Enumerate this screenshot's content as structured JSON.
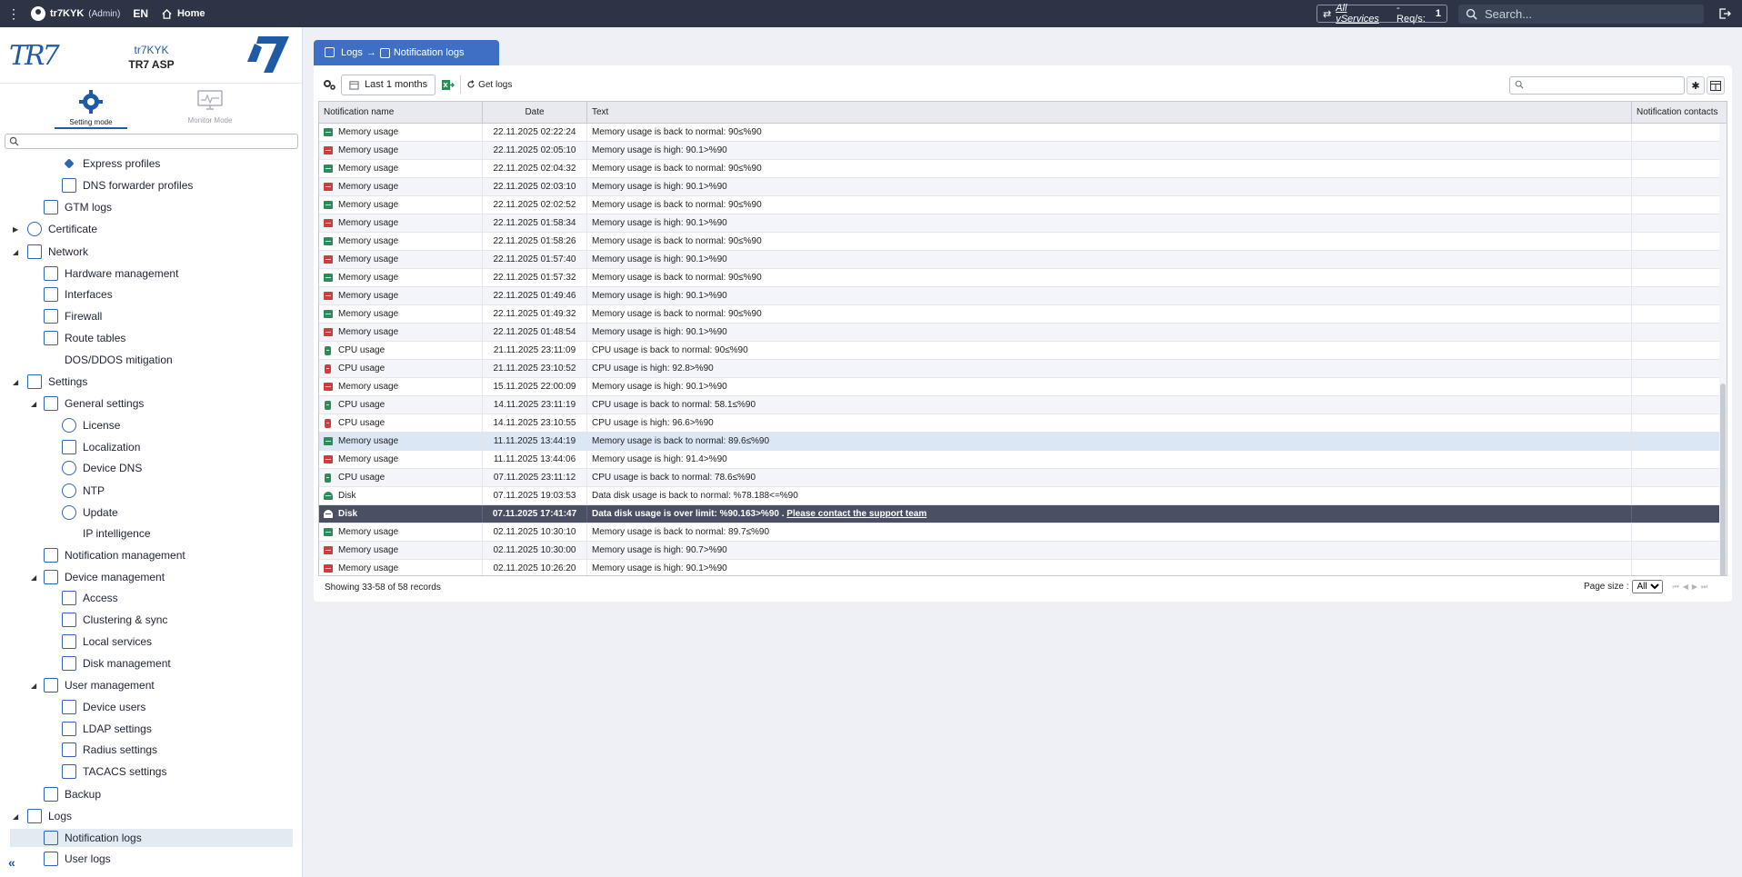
{
  "topbar": {
    "user": "tr7KYK",
    "role": "(Admin)",
    "lang": "EN",
    "home": "Home",
    "vservices_label": "All vServices",
    "reqs_label": "- Req/s:",
    "reqs_value": "1",
    "search_placeholder": "Search..."
  },
  "sidebar": {
    "logo_text": "TR7",
    "device_name": "tr7KYK",
    "model": "TR7 ASP",
    "modes": {
      "setting": "Setting mode",
      "monitor": "Monitor Mode"
    },
    "search_placeholder": "",
    "tree": [
      {
        "label": "Express profiles",
        "icon": "diamond-icon",
        "level": 3,
        "arrow": ""
      },
      {
        "label": "DNS forwarder profiles",
        "icon": "dns-forward-icon",
        "level": 3,
        "arrow": ""
      },
      {
        "label": "GTM logs",
        "icon": "log-list-icon",
        "level": 2,
        "arrow": ""
      },
      {
        "label": "Certificate",
        "icon": "certificate-icon",
        "level": 1,
        "arrow": "▶"
      },
      {
        "label": "Network",
        "icon": "network-icon",
        "level": 1,
        "arrow": "◢"
      },
      {
        "label": "Hardware management",
        "icon": "hardware-icon",
        "level": 2,
        "arrow": ""
      },
      {
        "label": "Interfaces",
        "icon": "interfaces-icon",
        "level": 2,
        "arrow": ""
      },
      {
        "label": "Firewall",
        "icon": "firewall-icon",
        "level": 2,
        "arrow": ""
      },
      {
        "label": "Route tables",
        "icon": "route-icon",
        "level": 2,
        "arrow": ""
      },
      {
        "label": "DOS/DDOS mitigation",
        "icon": "",
        "level": 2,
        "arrow": ""
      },
      {
        "label": "Settings",
        "icon": "gear-icon",
        "level": 1,
        "arrow": "◢"
      },
      {
        "label": "General settings",
        "icon": "settings-list-icon",
        "level": 2,
        "arrow": "◢"
      },
      {
        "label": "License",
        "icon": "license-icon",
        "level": 3,
        "arrow": ""
      },
      {
        "label": "Localization",
        "icon": "location-pin-icon",
        "level": 3,
        "arrow": ""
      },
      {
        "label": "Device DNS",
        "icon": "globe-icon",
        "level": 3,
        "arrow": ""
      },
      {
        "label": "NTP",
        "icon": "clock-icon",
        "level": 3,
        "arrow": ""
      },
      {
        "label": "Update",
        "icon": "update-icon",
        "level": 3,
        "arrow": ""
      },
      {
        "label": "IP intelligence",
        "icon": "",
        "level": 3,
        "arrow": ""
      },
      {
        "label": "Notification management",
        "icon": "bell-icon",
        "level": 2,
        "arrow": ""
      },
      {
        "label": "Device management",
        "icon": "device-icon",
        "level": 2,
        "arrow": "◢"
      },
      {
        "label": "Access",
        "icon": "access-icon",
        "level": 3,
        "arrow": ""
      },
      {
        "label": "Clustering & sync",
        "icon": "cluster-icon",
        "level": 3,
        "arrow": ""
      },
      {
        "label": "Local services",
        "icon": "local-services-icon",
        "level": 3,
        "arrow": ""
      },
      {
        "label": "Disk management",
        "icon": "disk-icon",
        "level": 3,
        "arrow": ""
      },
      {
        "label": "User management",
        "icon": "users-icon",
        "level": 2,
        "arrow": "◢"
      },
      {
        "label": "Device users",
        "icon": "device-users-icon",
        "level": 3,
        "arrow": ""
      },
      {
        "label": "LDAP settings",
        "icon": "wrench-icon",
        "level": 3,
        "arrow": ""
      },
      {
        "label": "Radius settings",
        "icon": "wrench-icon",
        "level": 3,
        "arrow": ""
      },
      {
        "label": "TACACS settings",
        "icon": "wrench-icon",
        "level": 3,
        "arrow": ""
      },
      {
        "label": "Backup",
        "icon": "backup-icon",
        "level": 2,
        "arrow": ""
      },
      {
        "label": "Logs",
        "icon": "logs-icon",
        "level": 1,
        "arrow": "◢"
      },
      {
        "label": "Notification logs",
        "icon": "log-list-icon",
        "level": 2,
        "arrow": "",
        "selected": true
      },
      {
        "label": "User logs",
        "icon": "log-list-icon",
        "level": 2,
        "arrow": ""
      }
    ],
    "collapse_label": "«"
  },
  "breadcrumb": {
    "parent": "Logs",
    "sep": "→",
    "current": "Notification logs"
  },
  "toolbar": {
    "range_label": "Last 1 months",
    "get_logs": "Get logs",
    "search_placeholder": ""
  },
  "table": {
    "columns": [
      "Notification name",
      "Date",
      "Text",
      "Notification contacts"
    ],
    "rows": [
      {
        "name": "Memory usage",
        "icon": "mem-ok",
        "date": "22.11.2025 02:22:24",
        "text": "Memory usage is back to normal: 90≤%90"
      },
      {
        "name": "Memory usage",
        "icon": "mem-bad",
        "date": "22.11.2025 02:05:10",
        "text": "Memory usage is high: 90.1>%90"
      },
      {
        "name": "Memory usage",
        "icon": "mem-ok",
        "date": "22.11.2025 02:04:32",
        "text": "Memory usage is back to normal: 90≤%90"
      },
      {
        "name": "Memory usage",
        "icon": "mem-bad",
        "date": "22.11.2025 02:03:10",
        "text": "Memory usage is high: 90.1>%90"
      },
      {
        "name": "Memory usage",
        "icon": "mem-ok",
        "date": "22.11.2025 02:02:52",
        "text": "Memory usage is back to normal: 90≤%90"
      },
      {
        "name": "Memory usage",
        "icon": "mem-bad",
        "date": "22.11.2025 01:58:34",
        "text": "Memory usage is high: 90.1>%90"
      },
      {
        "name": "Memory usage",
        "icon": "mem-ok",
        "date": "22.11.2025 01:58:26",
        "text": "Memory usage is back to normal: 90≤%90"
      },
      {
        "name": "Memory usage",
        "icon": "mem-bad",
        "date": "22.11.2025 01:57:40",
        "text": "Memory usage is high: 90.1>%90"
      },
      {
        "name": "Memory usage",
        "icon": "mem-ok",
        "date": "22.11.2025 01:57:32",
        "text": "Memory usage is back to normal: 90≤%90"
      },
      {
        "name": "Memory usage",
        "icon": "mem-bad",
        "date": "22.11.2025 01:49:46",
        "text": "Memory usage is high: 90.1>%90"
      },
      {
        "name": "Memory usage",
        "icon": "mem-ok",
        "date": "22.11.2025 01:49:32",
        "text": "Memory usage is back to normal: 90≤%90"
      },
      {
        "name": "Memory usage",
        "icon": "mem-bad",
        "date": "22.11.2025 01:48:54",
        "text": "Memory usage is high: 90.1>%90"
      },
      {
        "name": "CPU usage",
        "icon": "cpu-ok",
        "date": "21.11.2025 23:11:09",
        "text": "CPU usage is back to normal: 90≤%90"
      },
      {
        "name": "CPU usage",
        "icon": "cpu-bad",
        "date": "21.11.2025 23:10:52",
        "text": "CPU usage is high: 92.8>%90"
      },
      {
        "name": "Memory usage",
        "icon": "mem-bad",
        "date": "15.11.2025 22:00:09",
        "text": "Memory usage is high: 90.1>%90"
      },
      {
        "name": "CPU usage",
        "icon": "cpu-ok",
        "date": "14.11.2025 23:11:19",
        "text": "CPU usage is back to normal: 58.1≤%90"
      },
      {
        "name": "CPU usage",
        "icon": "cpu-bad",
        "date": "14.11.2025 23:10:55",
        "text": "CPU usage is high: 96.6>%90"
      },
      {
        "name": "Memory usage",
        "icon": "mem-ok",
        "date": "11.11.2025 13:44:19",
        "text": "Memory usage is back to normal: 89.6≤%90",
        "state": "hl"
      },
      {
        "name": "Memory usage",
        "icon": "mem-bad",
        "date": "11.11.2025 13:44:06",
        "text": "Memory usage is high: 91.4>%90"
      },
      {
        "name": "CPU usage",
        "icon": "cpu-ok",
        "date": "07.11.2025 23:11:12",
        "text": "CPU usage is back to normal: 78.6≤%90"
      },
      {
        "name": "Disk",
        "icon": "disk-ok",
        "date": "07.11.2025 19:03:53",
        "text": "Data disk usage is back to normal: %78.188<=%90"
      },
      {
        "name": "Disk",
        "icon": "disk-bad",
        "date": "07.11.2025 17:41:47",
        "text": "Data disk usage is over limit: %90.163>%90 . ",
        "link": "Please contact the support team",
        "state": "dark"
      },
      {
        "name": "Memory usage",
        "icon": "mem-ok",
        "date": "02.11.2025 10:30:10",
        "text": "Memory usage is back to normal: 89.7≤%90"
      },
      {
        "name": "Memory usage",
        "icon": "mem-bad",
        "date": "02.11.2025 10:30:00",
        "text": "Memory usage is high: 90.7>%90"
      },
      {
        "name": "Memory usage",
        "icon": "mem-bad",
        "date": "02.11.2025 10:26:20",
        "text": "Memory usage is high: 90.1>%90"
      }
    ],
    "records_text": "Showing 33-58 of 58 records",
    "page_size_label": "Page size :",
    "page_size_value": "All"
  },
  "colors": {
    "topbar": "#2c3446",
    "accent": "#3d6fc4",
    "ok": "#2e8b57",
    "bad": "#d23b3b"
  }
}
